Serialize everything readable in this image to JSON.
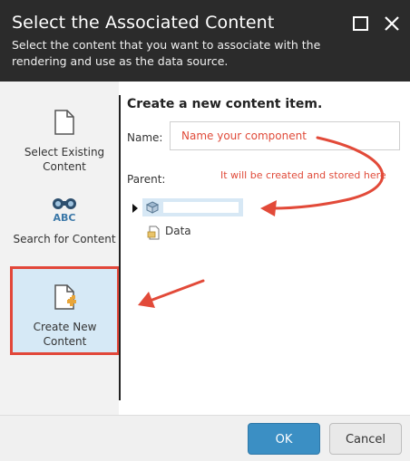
{
  "dialog": {
    "title": "Select the Associated Content",
    "subtitle": "Select the content that you want to associate with the rendering and use as the data source."
  },
  "sidebar": {
    "items": [
      {
        "label": "Select Existing Content",
        "icon": "document-icon"
      },
      {
        "label": "Search for Content",
        "icon": "binoculars-abc-icon"
      },
      {
        "label": "Create New Content",
        "icon": "new-document-icon",
        "active": true
      }
    ]
  },
  "main": {
    "section_title": "Create a new content item.",
    "name_label": "Name:",
    "name_value": "Name your component",
    "parent_label": "Parent:",
    "annotation": "It will be created and stored here",
    "tree": {
      "selected_node_icon": "content-node-icon",
      "child_label": "Data"
    }
  },
  "footer": {
    "ok_label": "OK",
    "cancel_label": "Cancel"
  },
  "colors": {
    "header_bg": "#2b2b2b",
    "annotation_red": "#e04b3a",
    "selection_blue": "#d7e8f5",
    "ok_blue": "#3b8fc4"
  }
}
